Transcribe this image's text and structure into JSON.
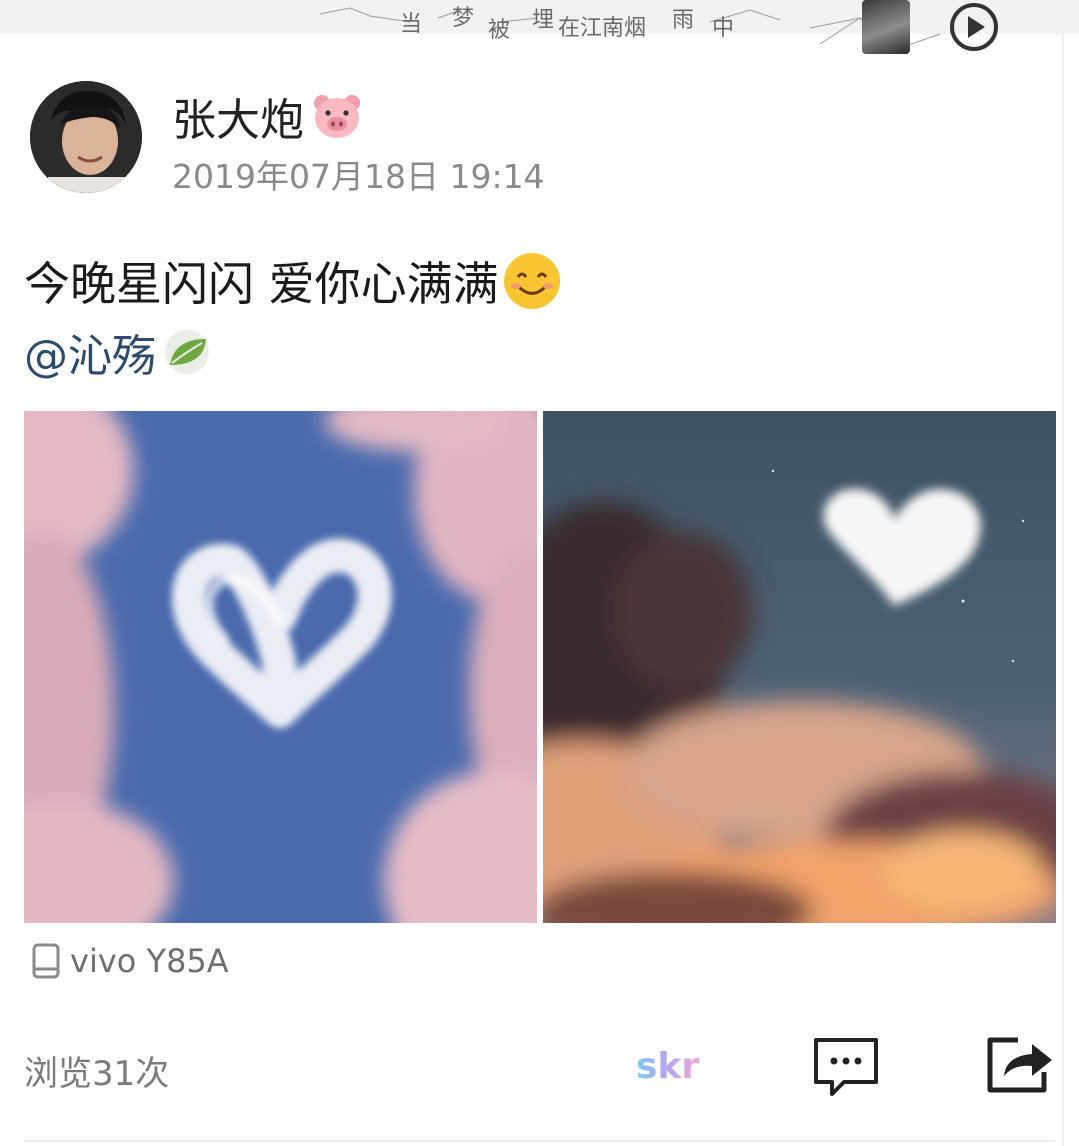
{
  "banner": {
    "lyrics": [
      "当",
      "梦",
      "被",
      "埋",
      "在江南烟",
      "雨",
      "中"
    ],
    "thumb_icon": "artist-thumbnail",
    "play_icon": "play-circle-icon"
  },
  "post": {
    "username": "张大炮",
    "username_emoji": "pig-face-icon",
    "timestamp": "2019年07月18日 19:14",
    "content": "今晚星闪闪 爱你心满满",
    "content_emoji": "smiling-face-icon",
    "mention": "@沁殇",
    "mention_badge": "green-leaf-icon",
    "images": [
      "heart-cloud-blue-sky",
      "heart-cloud-dusk-sky"
    ],
    "device": "vivo Y85A"
  },
  "footer": {
    "views": "浏览31次",
    "skr_label": "skr",
    "comment_icon": "comment-icon",
    "share_icon": "share-icon"
  },
  "colors": {
    "mention": "#2c4a6b",
    "muted": "#8a8a8a",
    "sky_blue": "#4a6aad"
  }
}
